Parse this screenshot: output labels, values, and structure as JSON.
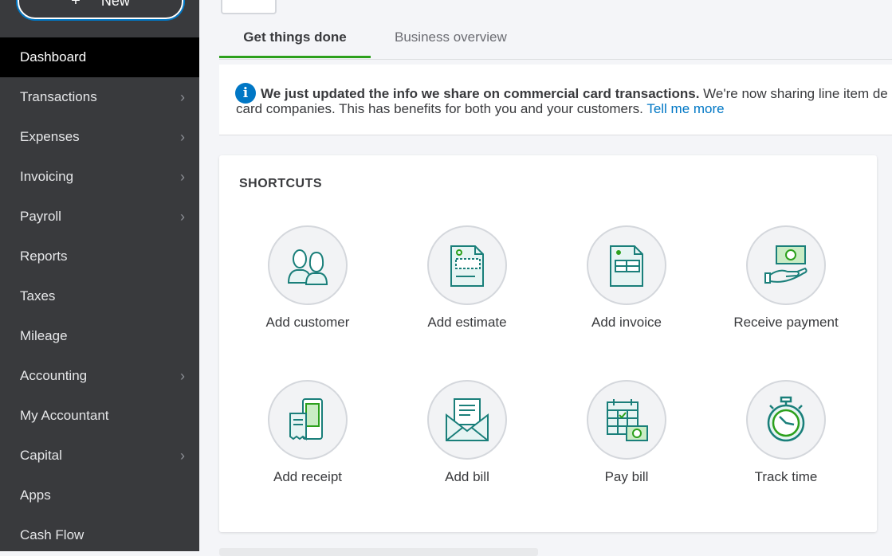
{
  "sidebar": {
    "new_label": "New",
    "items": [
      {
        "label": "Dashboard",
        "active": true,
        "chevron": false
      },
      {
        "label": "Transactions",
        "chevron": true
      },
      {
        "label": "Expenses",
        "chevron": true
      },
      {
        "label": "Invoicing",
        "chevron": true
      },
      {
        "label": "Payroll",
        "chevron": true
      },
      {
        "label": "Reports",
        "chevron": false
      },
      {
        "label": "Taxes",
        "chevron": false
      },
      {
        "label": "Mileage",
        "chevron": false
      },
      {
        "label": "Accounting",
        "chevron": true
      },
      {
        "label": "My Accountant",
        "chevron": false
      },
      {
        "label": "Capital",
        "chevron": true
      },
      {
        "label": "Apps",
        "chevron": false
      },
      {
        "label": "Cash Flow",
        "chevron": false
      }
    ]
  },
  "tabs": [
    {
      "label": "Get things done",
      "active": true
    },
    {
      "label": "Business overview",
      "active": false
    }
  ],
  "banner": {
    "bold": "We just updated the info we share on commercial card transactions.",
    "text1": " We're now sharing line item de",
    "text2": "card companies. This has benefits for both you and your customers. ",
    "link": "Tell me more"
  },
  "shortcuts": {
    "title": "SHORTCUTS",
    "items": [
      {
        "label": "Add customer",
        "icon": "add-customer-icon"
      },
      {
        "label": "Add estimate",
        "icon": "add-estimate-icon"
      },
      {
        "label": "Add invoice",
        "icon": "add-invoice-icon"
      },
      {
        "label": "Receive payment",
        "icon": "receive-payment-icon"
      },
      {
        "label": "Add receipt",
        "icon": "add-receipt-icon"
      },
      {
        "label": "Add bill",
        "icon": "add-bill-icon"
      },
      {
        "label": "Pay bill",
        "icon": "pay-bill-icon"
      },
      {
        "label": "Track time",
        "icon": "track-time-icon"
      }
    ]
  },
  "colors": {
    "sidebar_bg": "#393a3d",
    "active_item": "#000000",
    "accent_green": "#2ca01c",
    "link_blue": "#0077c5",
    "icon_teal": "#00a398"
  }
}
